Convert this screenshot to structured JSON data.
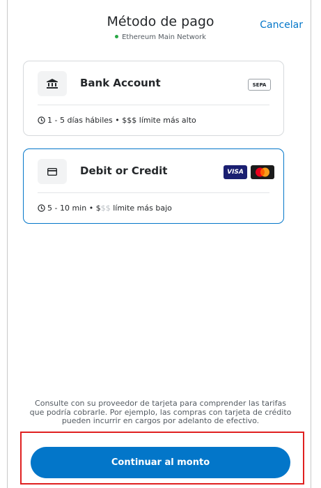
{
  "header": {
    "title": "Método de pago",
    "network": "Ethereum Main Network",
    "network_status_color": "#28a745",
    "cancel_label": "Cancelar"
  },
  "methods": [
    {
      "icon": "bank-icon",
      "title": "Bank Account",
      "badge": "SEPA",
      "time": "1 - 5 días hábiles",
      "separator": "•",
      "limit_strong": "$$$",
      "limit_muted": "",
      "limit_text": "límite más alto",
      "selected": false
    },
    {
      "icon": "card-icon",
      "title": "Debit or Credit",
      "badges": [
        "VISA",
        "mastercard"
      ],
      "time": "5 - 10 min",
      "separator": "•",
      "limit_strong": "$",
      "limit_muted": "$$",
      "limit_text": "límite más bajo",
      "selected": true
    }
  ],
  "disclaimer": "Consulte con su proveedor de tarjeta para comprender las tarifas que podría cobrarle. Por ejemplo, las compras con tarjeta de crédito pueden incurrir en cargos por adelanto de efectivo.",
  "cta": {
    "label": "Continuar al monto"
  },
  "colors": {
    "accent": "#0376c9",
    "highlight": "#e02020"
  }
}
